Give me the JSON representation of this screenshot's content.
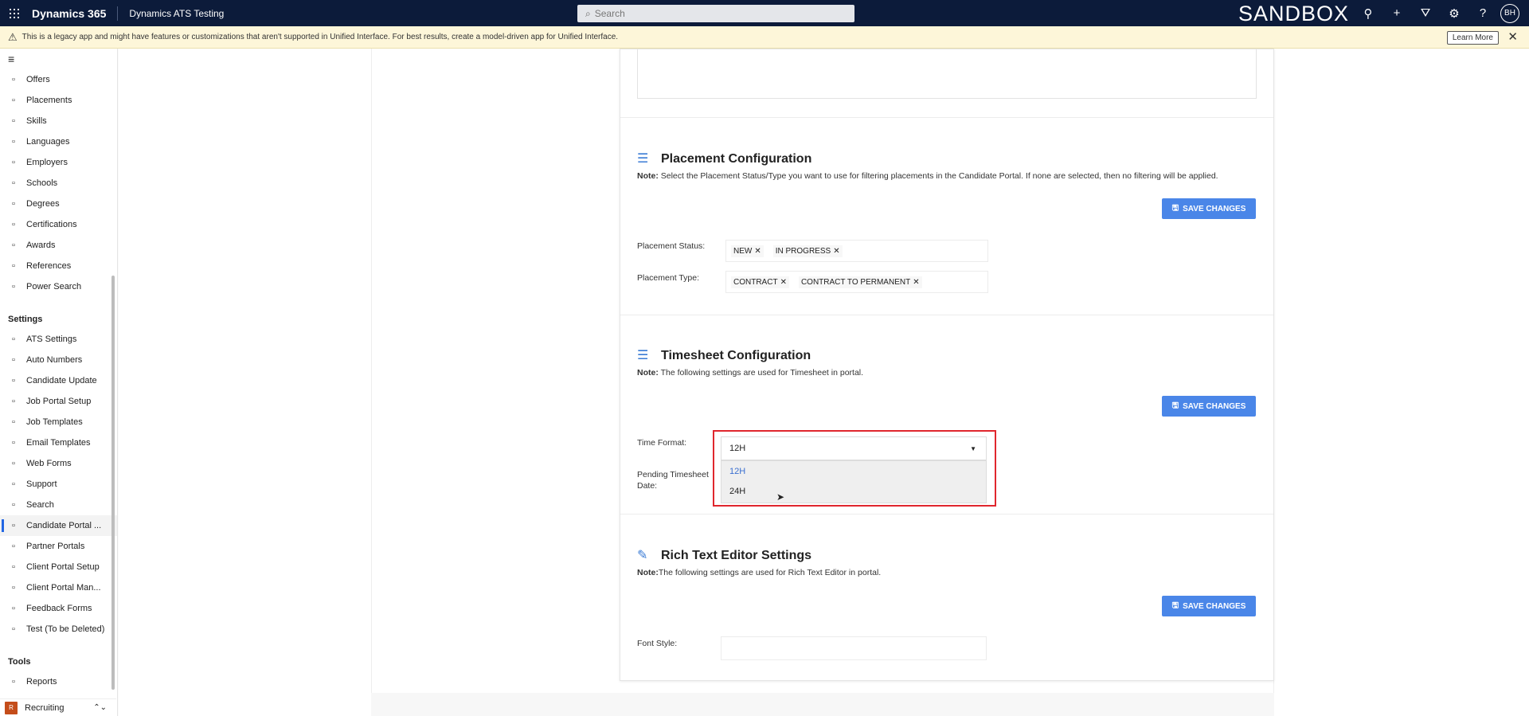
{
  "topbar": {
    "brand": "Dynamics 365",
    "app_name": "Dynamics ATS Testing",
    "search_placeholder": "Search",
    "environment": "SANDBOX",
    "avatar_initials": "BH",
    "icons": [
      "lightbulb-icon",
      "plus-icon",
      "filter-icon",
      "gear-icon",
      "help-icon"
    ]
  },
  "banner": {
    "message": "This is a legacy app and might have features or customizations that aren't supported in Unified Interface. For best results, create a model-driven app for Unified Interface.",
    "learn_more": "Learn More"
  },
  "sidebar": {
    "items": [
      {
        "label": "Offers",
        "icon": "document-icon"
      },
      {
        "label": "Placements",
        "icon": "people-icon"
      },
      {
        "label": "Skills",
        "icon": "skills-icon"
      },
      {
        "label": "Languages",
        "icon": "globe-icon"
      },
      {
        "label": "Employers",
        "icon": "building-icon"
      },
      {
        "label": "Schools",
        "icon": "school-icon"
      },
      {
        "label": "Degrees",
        "icon": "book-icon"
      },
      {
        "label": "Certifications",
        "icon": "certificate-icon"
      },
      {
        "label": "Awards",
        "icon": "award-icon"
      },
      {
        "label": "References",
        "icon": "contact-icon"
      },
      {
        "label": "Power Search",
        "icon": "search-icon"
      }
    ],
    "settings_title": "Settings",
    "settings": [
      {
        "label": "ATS Settings",
        "icon": "gear-icon"
      },
      {
        "label": "Auto Numbers",
        "icon": "list-number-icon"
      },
      {
        "label": "Candidate Update",
        "icon": "person-icon"
      },
      {
        "label": "Job Portal Setup",
        "icon": "portal-icon"
      },
      {
        "label": "Job Templates",
        "icon": "template-icon"
      },
      {
        "label": "Email Templates",
        "icon": "email-icon"
      },
      {
        "label": "Web Forms",
        "icon": "form-icon"
      },
      {
        "label": "Support",
        "icon": "help-circle-icon"
      },
      {
        "label": "Search",
        "icon": "search-people-icon"
      },
      {
        "label": "Candidate Portal ...",
        "icon": "portal-person-icon",
        "active": true
      },
      {
        "label": "Partner Portals",
        "icon": "partner-icon"
      },
      {
        "label": "Client Portal Setup",
        "icon": "client-icon"
      },
      {
        "label": "Client Portal Man...",
        "icon": "client-manage-icon"
      },
      {
        "label": "Feedback Forms",
        "icon": "feedback-icon"
      },
      {
        "label": "Test (To be Deleted)",
        "icon": "calendar-icon"
      }
    ],
    "tools_title": "Tools",
    "tools": [
      {
        "label": "Reports",
        "icon": "report-icon"
      }
    ],
    "area": {
      "badge": "R",
      "label": "Recruiting"
    }
  },
  "placement": {
    "title": "Placement Configuration",
    "note_prefix": "Note:",
    "note": " Select the Placement Status/Type you want to use for filtering placements in the Candidate Portal. If none are selected, then no filtering will be applied.",
    "save_label": "SAVE CHANGES",
    "status_label": "Placement Status:",
    "status_tags": [
      "NEW",
      "IN PROGRESS"
    ],
    "type_label": "Placement Type:",
    "type_tags": [
      "CONTRACT",
      "CONTRACT TO PERMANENT"
    ]
  },
  "timesheet": {
    "title": "Timesheet Configuration",
    "note_prefix": "Note:",
    "note": " The following settings are used for Timesheet in portal.",
    "save_label": "SAVE CHANGES",
    "time_format_label": "Time Format:",
    "time_format_value": "12H",
    "options": [
      "12H",
      "24H"
    ],
    "pending_label": "Pending Timesheet Date:"
  },
  "rte": {
    "title": "Rich Text Editor Settings",
    "note_prefix": "Note:",
    "note": "The following settings are used for Rich Text Editor in portal.",
    "save_label": "SAVE CHANGES",
    "font_style_label": "Font Style:"
  }
}
